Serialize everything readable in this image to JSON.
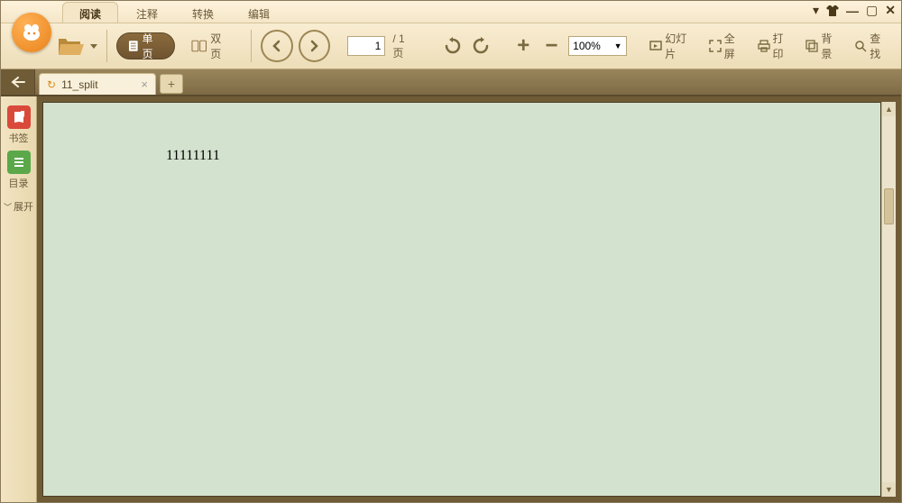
{
  "menu": {
    "tabs": [
      "阅读",
      "注释",
      "转换",
      "编辑"
    ],
    "active": 0
  },
  "toolbar": {
    "single_page": "单页",
    "double_page": "双页",
    "page_current": "1",
    "page_total": "/ 1页",
    "zoom_value": "100%",
    "slideshow": "幻灯片",
    "fullscreen": "全屏",
    "print": "打印",
    "background": "背景",
    "find": "查找",
    "plus": "+",
    "minus": "−"
  },
  "doctab": {
    "title": "11_split",
    "newtab": "+"
  },
  "sidebar": {
    "bookmark": "书签",
    "toc": "目录",
    "expand": "展开"
  },
  "document": {
    "content": "11111111"
  }
}
